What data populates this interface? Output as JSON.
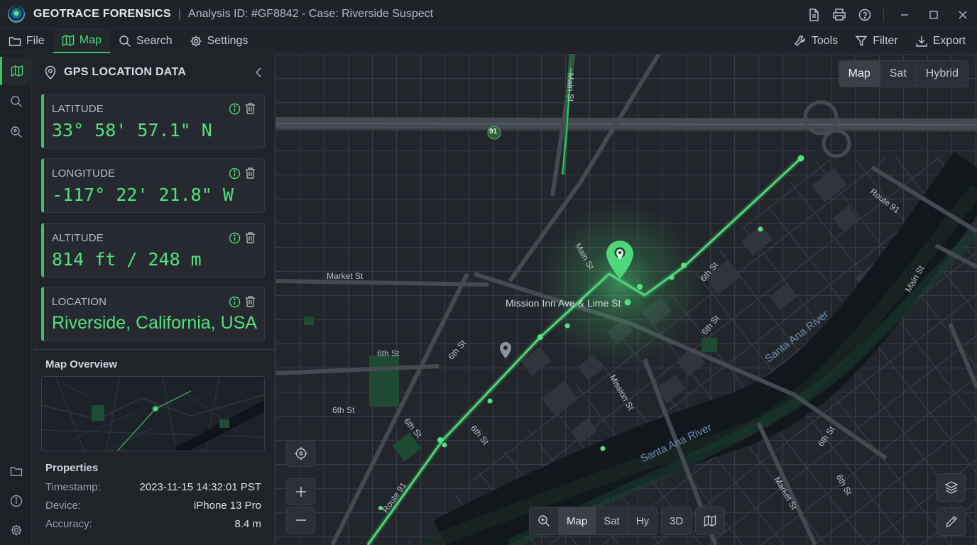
{
  "window": {
    "app_name": "GEOTRACE FORENSICS",
    "separator": "|",
    "case_title": "Analysis ID: #GF8842 - Case: Riverside Suspect",
    "title_icons": [
      "document-icon",
      "print-icon",
      "help-icon"
    ],
    "window_controls": [
      "minimize-icon",
      "maximize-icon",
      "close-icon"
    ]
  },
  "menu": {
    "left": [
      {
        "label": "File",
        "icon": "folder-icon"
      },
      {
        "label": "Map",
        "icon": "map-icon",
        "active": true
      },
      {
        "label": "Search",
        "icon": "search-icon"
      },
      {
        "label": "Settings",
        "icon": "gear-icon"
      }
    ],
    "right": [
      {
        "label": "Tools",
        "icon": "wrench-icon"
      },
      {
        "label": "Filter",
        "icon": "filter-icon"
      },
      {
        "label": "Export",
        "icon": "download-icon"
      }
    ]
  },
  "panel": {
    "title": "GPS LOCATION DATA",
    "cards": [
      {
        "label": "LATITUDE",
        "value": "33° 58' 57.1\" N"
      },
      {
        "label": "LONGITUDE",
        "value": "-117° 22' 21.8\" W"
      },
      {
        "label": "ALTITUDE",
        "value": "814 ft / 248 m"
      },
      {
        "label": "LOCATION",
        "value": "Riverside, California, USA"
      }
    ],
    "overview_title": "Map Overview",
    "properties_title": "Properties",
    "properties": [
      {
        "key": "Timestamp:",
        "value": "2023-11-15 14:32:01 PST"
      },
      {
        "key": "Device:",
        "value": "iPhone 13 Pro"
      },
      {
        "key": "Accuracy:",
        "value": "8.4 m"
      }
    ]
  },
  "map": {
    "type_options": [
      "Map",
      "Sat",
      "Hybrid"
    ],
    "type_selected": "Map",
    "bottom_options": [
      "Map",
      "Sat",
      "Hy"
    ],
    "bottom_3d": "3D",
    "highway_shield": "91",
    "labels": {
      "market_st": "Market St",
      "sixth_st_a": "6th St",
      "sixth_st_b": "6th St",
      "sixth_st_c": "6th St",
      "sixth_st_d": "6th St",
      "sixth_st_e": "6th St",
      "sixth_st_f": "6th St",
      "sixth_st_g": "6th St",
      "sixth_st_h": "6th St",
      "sixth_st_i": "6th St",
      "main_st_a": "Main St",
      "main_st_b": "Main St",
      "main_st_c": "Main St",
      "mission_st": "Mission St",
      "market_st_b": "Market St",
      "route_91_a": "Route 91",
      "route_91_b": "Route 91",
      "santa_ana_a": "Santa Ana River",
      "santa_ana_b": "Santa Ana River",
      "poi": "Mission Inn Ave & Lime St"
    },
    "accent": "#3fbf67"
  }
}
